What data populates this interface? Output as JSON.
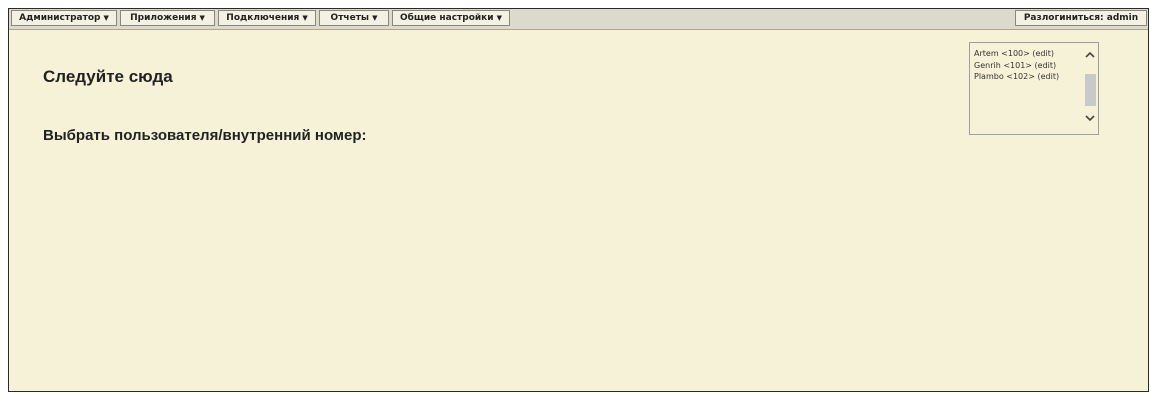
{
  "menu": {
    "items": [
      {
        "label": "Администратор"
      },
      {
        "label": "Приложения"
      },
      {
        "label": "Подключения"
      },
      {
        "label": "Отчеты"
      },
      {
        "label": "Общие настройки"
      }
    ],
    "arrow": "▼",
    "logout_label": "Разлогиниться: admin"
  },
  "main": {
    "follow_heading": "Следуйте сюда",
    "select_heading": "Выбрать пользователя/внутренний номер:"
  },
  "user_list": {
    "items": [
      {
        "name": "Artem <100>",
        "edit": "(edit)"
      },
      {
        "name": "Genrih <101>",
        "edit": "(edit)"
      },
      {
        "name": "Plambo <102>",
        "edit": "(edit)"
      }
    ],
    "scroll_up_glyph": "⌃",
    "scroll_down_glyph": "⌄"
  }
}
